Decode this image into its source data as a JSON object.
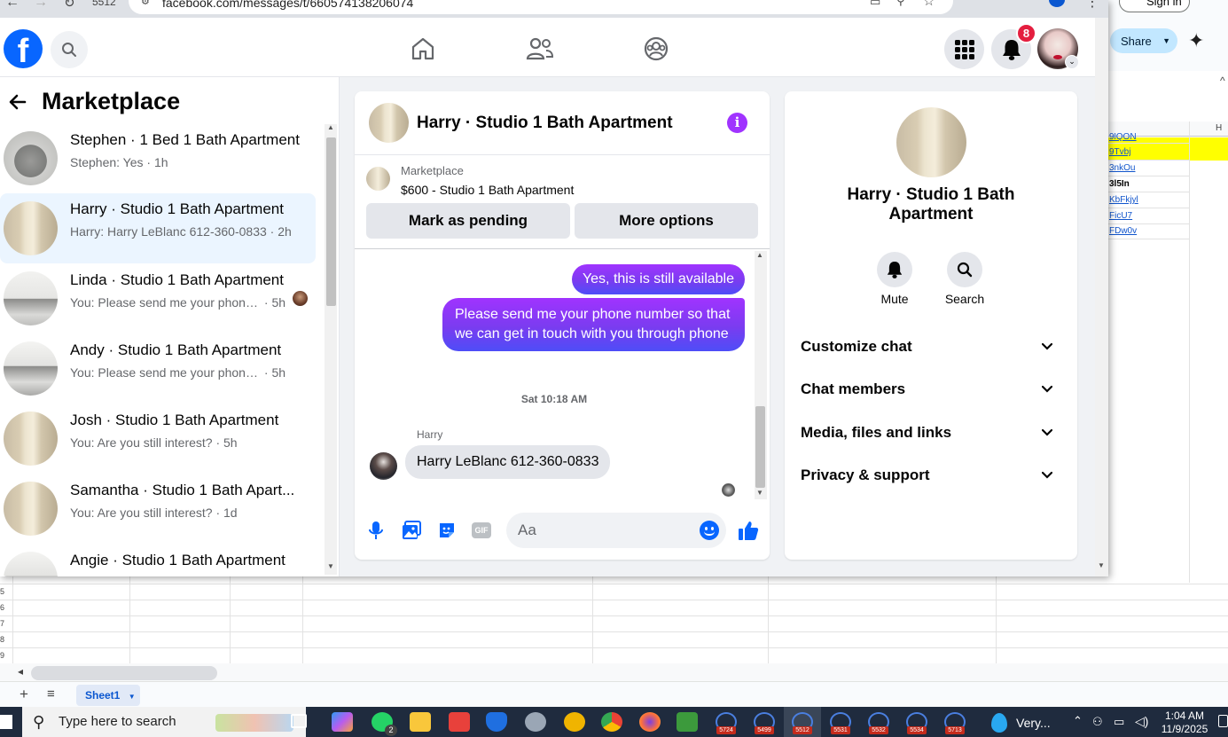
{
  "browser": {
    "url": "facebook.com/messages/t/660574138206074",
    "tab_counter": "5512"
  },
  "fb_nav": {
    "notifications_count": "8",
    "brand_color": "#0866ff"
  },
  "left_panel": {
    "title": "Marketplace",
    "conversations": [
      {
        "title": "Stephen · 1 Bed 1 Bath Apartment",
        "preview": "Stephen: Yes",
        "time": "· 1h"
      },
      {
        "title": "Harry · Studio 1 Bath Apartment",
        "preview": "Harry: Harry LeBlanc 612-360-0833",
        "time": "· 2h"
      },
      {
        "title": "Linda · Studio 1 Bath Apartment",
        "preview": "You: Please send me your phone...",
        "time": "· 5h"
      },
      {
        "title": "Andy · Studio 1 Bath Apartment",
        "preview": "You: Please send me your phone n...",
        "time": "· 5h"
      },
      {
        "title": "Josh · Studio 1 Bath Apartment",
        "preview": "You: Are you still interest?",
        "time": "· 5h"
      },
      {
        "title": "Samantha · Studio 1 Bath Apart...",
        "preview": "You: Are you still interest?",
        "time": "· 1d"
      },
      {
        "title": "Angie · Studio 1 Bath Apartment",
        "preview": "",
        "time": ""
      }
    ]
  },
  "chat": {
    "title": "Harry · Studio 1 Bath Apartment",
    "marketplace_label": "Marketplace",
    "listing": "$600 - Studio 1 Bath Apartment",
    "mark_pending": "Mark as pending",
    "more_options": "More options",
    "msg_out_1": "Yes, this is still available",
    "msg_out_2": "Please send me your phone  number so that we can get in touch with you through phone",
    "timestamp": "Sat 10:18 AM",
    "sender_name": "Harry",
    "msg_in_1": "Harry LeBlanc 612-360-0833",
    "composer_placeholder": "Aa",
    "gif_label": "GIF",
    "accent": "#a033ff"
  },
  "info_panel": {
    "title": "Harry · Studio 1 Bath Apartment",
    "mute": "Mute",
    "search": "Search",
    "sections": [
      "Customize chat",
      "Chat members",
      "Media, files and links",
      "Privacy & support"
    ]
  },
  "spreadsheet": {
    "share": "Share",
    "sign_in": "Sign in",
    "column_h": "H",
    "cells": [
      "9lQON",
      "9Tvbj",
      "3nkOu",
      "3l5In",
      "KbFkjyl",
      "FicU7",
      "FDw0v"
    ],
    "sheet_tab": "Sheet1",
    "row_numbers": [
      "5",
      "6",
      "7",
      "8",
      "9"
    ]
  },
  "taskbar": {
    "search_placeholder": "Type here to search",
    "whatsapp_badge": "2",
    "badges": [
      "5724",
      "5499",
      "5512",
      "5531",
      "5532",
      "5534",
      "5713"
    ],
    "weather": "Very...",
    "time": "1:04 AM",
    "date": "11/9/2025"
  }
}
